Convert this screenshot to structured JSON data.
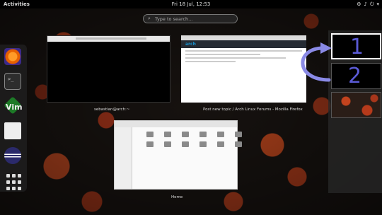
{
  "topbar": {
    "activities_label": "Activities",
    "clock": "Fri 18 Jul, 12:53",
    "tray_icons": [
      "network-icon",
      "volume-icon",
      "power-icon",
      "chevron-down-icon"
    ]
  },
  "search": {
    "placeholder": "Type to search..."
  },
  "dash": {
    "apps": [
      "firefox",
      "terminal",
      "vim",
      "files",
      "eclipse",
      "show-applications"
    ],
    "vim_label": "Vim"
  },
  "windows": {
    "terminal_caption": "sebastian@arch:~",
    "firefox_caption": "Post new topic / Arch Linux Forums - Mozilla Firefox",
    "firefox_logo_text": "arch",
    "files_caption": "Home"
  },
  "workspaces": {
    "labels": [
      "1",
      "2"
    ]
  },
  "colors": {
    "annotation": "#5b5bd6",
    "topbar": "#000000"
  }
}
